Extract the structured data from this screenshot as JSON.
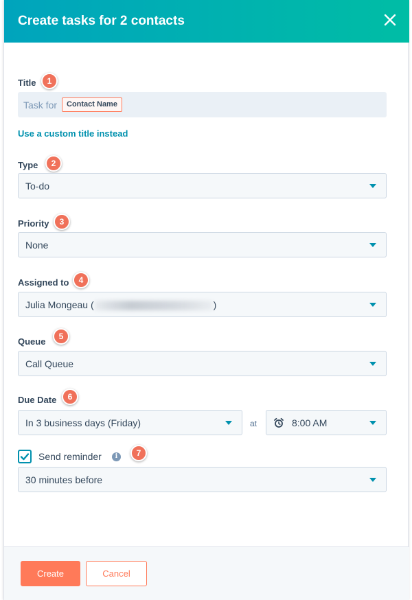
{
  "header": {
    "title": "Create tasks for 2 contacts"
  },
  "form": {
    "title": {
      "label": "Title",
      "marker": "1",
      "prefix": "Task for",
      "token": "Contact Name"
    },
    "custom_title_link": "Use a custom title instead",
    "type": {
      "label": "Type",
      "marker": "2",
      "value": "To-do"
    },
    "priority": {
      "label": "Priority",
      "marker": "3",
      "value": "None"
    },
    "assigned_to": {
      "label": "Assigned to",
      "marker": "4",
      "name": "Julia Mongeau (",
      "suffix": ")"
    },
    "queue": {
      "label": "Queue",
      "marker": "5",
      "value": "Call Queue"
    },
    "due_date": {
      "label": "Due Date",
      "marker": "6",
      "date_value": "In 3 business days (Friday)",
      "at_label": "at",
      "time_value": "8:00 AM"
    },
    "reminder": {
      "label": "Send reminder",
      "marker": "7",
      "checked": true,
      "value": "30 minutes before"
    }
  },
  "footer": {
    "create_label": "Create",
    "cancel_label": "Cancel"
  },
  "colors": {
    "accent": "#00a4bd",
    "primary_button": "#ff7a59",
    "marker": "#f0715a",
    "link": "#0091ae"
  },
  "icons": {
    "close": "close-icon",
    "caret": "chevron-down-icon",
    "clock": "alarm-clock-icon",
    "info": "info-icon",
    "check": "checkmark-icon"
  }
}
